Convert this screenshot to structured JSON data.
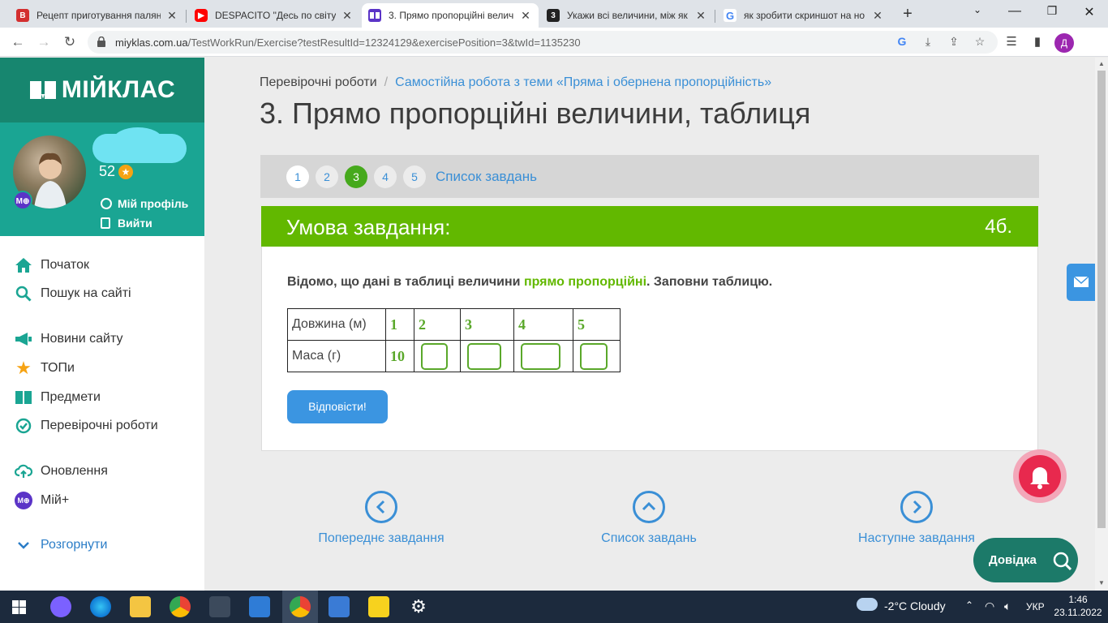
{
  "browser": {
    "tabs": [
      {
        "title": "Рецепт приготування палян",
        "icon_text": "B",
        "icon_color": "#d32f2f"
      },
      {
        "title": "DESPACITO \"Десь по світу\" у",
        "icon_text": "▶",
        "icon_color": "#ff0000"
      },
      {
        "title": "3. Прямо пропорційні велич",
        "icon_text": "",
        "icon_color": "#5b34c7",
        "active": true
      },
      {
        "title": "Укажи всі величини, між як",
        "icon_text": "3",
        "icon_color": "#222222"
      },
      {
        "title": "як зробити скриншот на но",
        "icon_text": "G",
        "icon_color": "#4285f4"
      }
    ],
    "url_host": "miyklas.com.ua",
    "url_path": "/TestWorkRun/Exercise?testResultId=12324129&exercisePosition=3&twId=1135230",
    "profile_initial": "Д"
  },
  "sidebar": {
    "brand": "МІЙКЛАС",
    "avatar_badge": "M⊕",
    "points": "52",
    "profile_link": "Мій профіль",
    "logout_link": "Вийти",
    "nav": [
      {
        "label": "Початок",
        "icon": "home-icon"
      },
      {
        "label": "Пошук на сайті",
        "icon": "search-icon"
      },
      {
        "label": "Новини сайту",
        "icon": "megaphone-icon"
      },
      {
        "label": "ТОПи",
        "icon": "star-icon"
      },
      {
        "label": "Предмети",
        "icon": "book-icon"
      },
      {
        "label": "Перевірочні роботи",
        "icon": "check-circle-icon"
      },
      {
        "label": "Оновлення",
        "icon": "cloud-upload-icon"
      },
      {
        "label": "Мій+",
        "icon": "myplus-icon"
      },
      {
        "label": "Розгорнути",
        "icon": "chevron-down-icon"
      }
    ]
  },
  "main": {
    "breadcrumb_root": "Перевірочні роботи",
    "breadcrumb_sep": "/",
    "breadcrumb_link": "Самостійна робота з теми «Пряма і обернена пропорційність»",
    "title": "3. Прямо пропорційні величини, таблиця",
    "pager": {
      "pages": [
        "1",
        "2",
        "3",
        "4",
        "5"
      ],
      "current": "3",
      "list_label": "Список завдань"
    },
    "task": {
      "header": "Умова завдання:",
      "points": "4б.",
      "prompt_before": "Відомо, що дані в таблиці величини ",
      "prompt_highlight": "прямо пропорційні",
      "prompt_after": ". Заповни таблицю.",
      "table": {
        "row1_label": "Довжина (м)",
        "row1_values": [
          "1",
          "2",
          "3",
          "4",
          "5"
        ],
        "row2_label": "Маса (г)",
        "row2_given": "10"
      },
      "answer_button": "Відповісти!"
    },
    "bottom_nav": {
      "prev": "Попереднє завдання",
      "list": "Список завдань",
      "next": "Наступне завдання"
    },
    "help_button": "Довідка"
  },
  "taskbar": {
    "weather": "-2°C  Cloudy",
    "language": "УКР",
    "time": "1:46",
    "date": "23.11.2022"
  },
  "colors": {
    "brand_dark": "#17866f",
    "brand_light": "#1aa593",
    "accent_green": "#62b800",
    "link_blue": "#3a8fd6",
    "button_blue": "#3b95e1",
    "bell_red": "#e8294e"
  }
}
